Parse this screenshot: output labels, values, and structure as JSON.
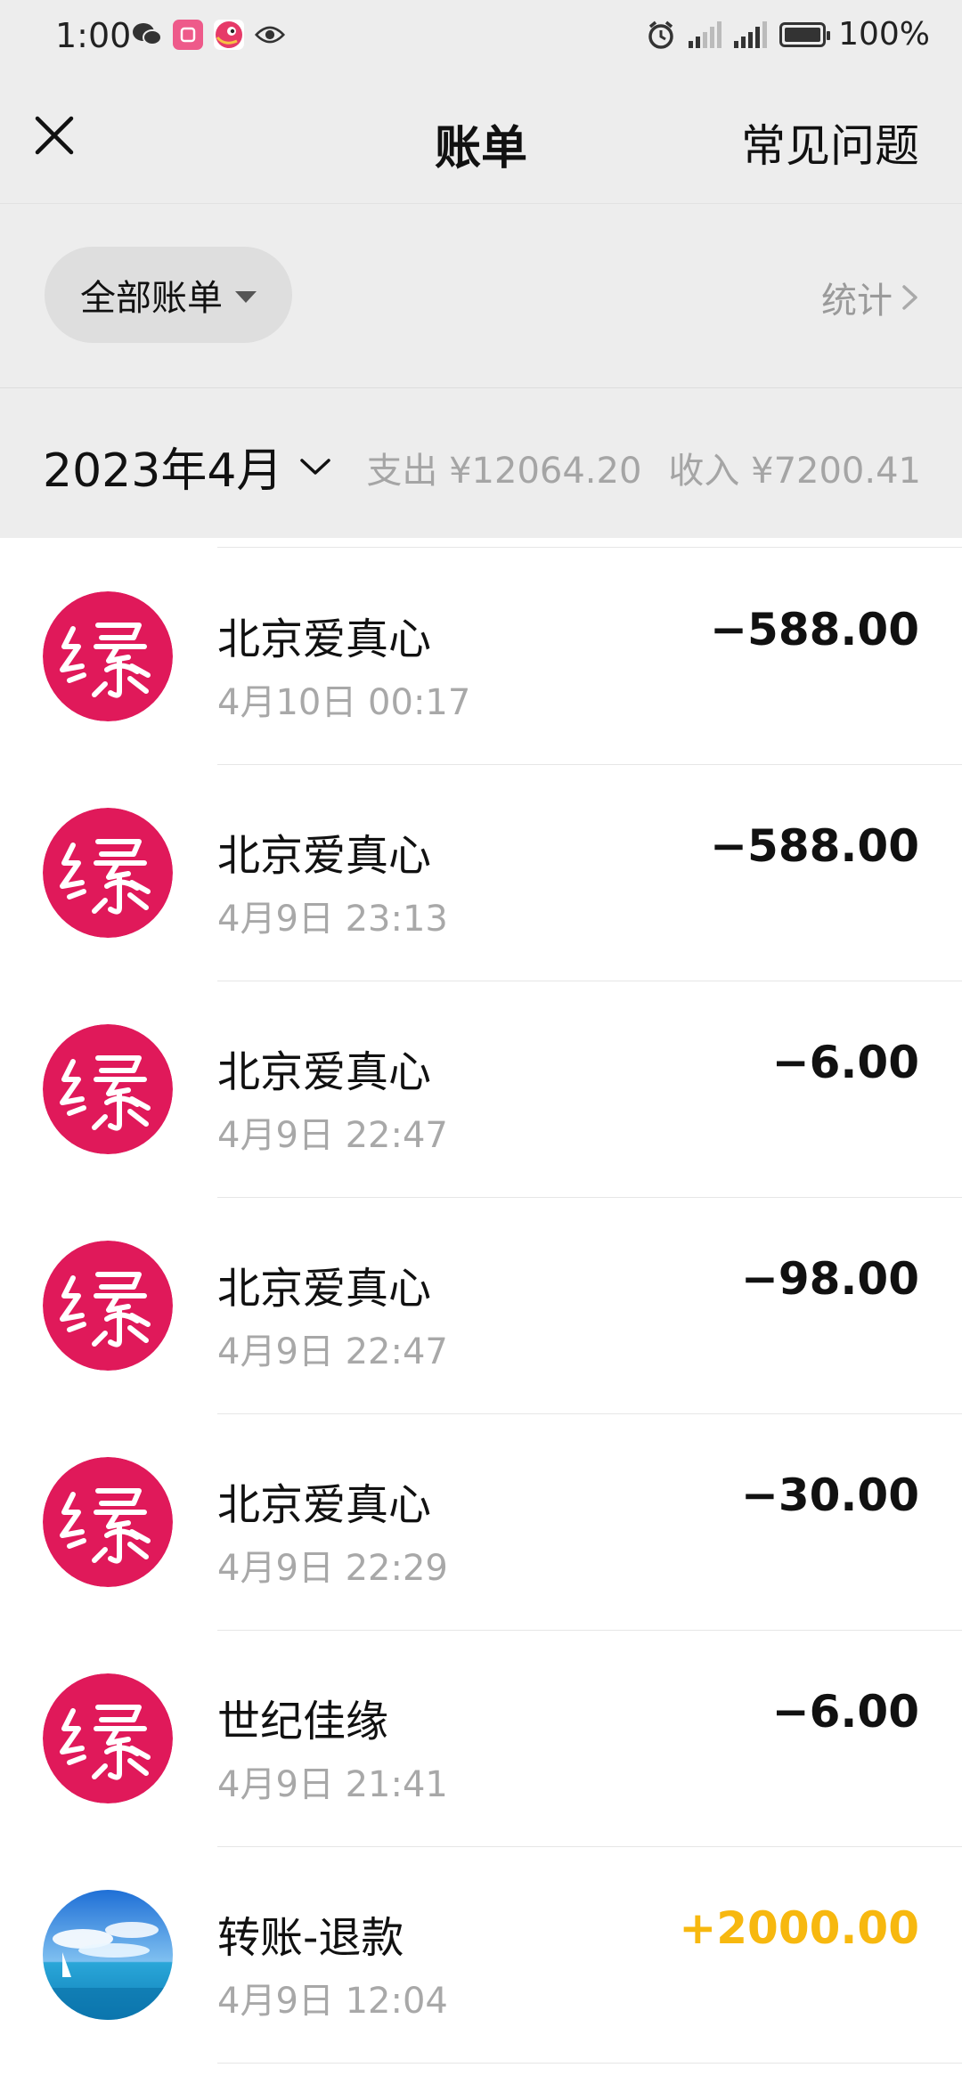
{
  "status_bar": {
    "time": "1:00",
    "battery": "100%"
  },
  "nav": {
    "title": "账单",
    "faq": "常见问题"
  },
  "filter": {
    "label": "全部账单",
    "stats": "统计"
  },
  "month": {
    "label": "2023年4月",
    "expense": "支出 ¥12064.20",
    "income": "收入 ¥7200.41"
  },
  "colors": {
    "brand_red": "#e0195a",
    "income_yellow": "#f7b80f",
    "background": "#ededed"
  },
  "transactions": [
    {
      "title": "北京爱真心",
      "time": "4月10日 00:17",
      "amount": "−588.00",
      "icon": "yuan-app-icon"
    },
    {
      "title": "北京爱真心",
      "time": "4月9日 23:13",
      "amount": "−588.00",
      "icon": "yuan-app-icon"
    },
    {
      "title": "北京爱真心",
      "time": "4月9日 22:47",
      "amount": "−6.00",
      "icon": "yuan-app-icon"
    },
    {
      "title": "北京爱真心",
      "time": "4月9日 22:47",
      "amount": "−98.00",
      "icon": "yuan-app-icon"
    },
    {
      "title": "北京爱真心",
      "time": "4月9日 22:29",
      "amount": "−30.00",
      "icon": "yuan-app-icon"
    },
    {
      "title": "世纪佳缘",
      "time": "4月9日 21:41",
      "amount": "−6.00",
      "icon": "yuan-app-icon"
    },
    {
      "title": "转账-退款",
      "time": "4月9日 12:04",
      "amount": "+2000.00",
      "icon": "sea-photo-avatar"
    }
  ]
}
